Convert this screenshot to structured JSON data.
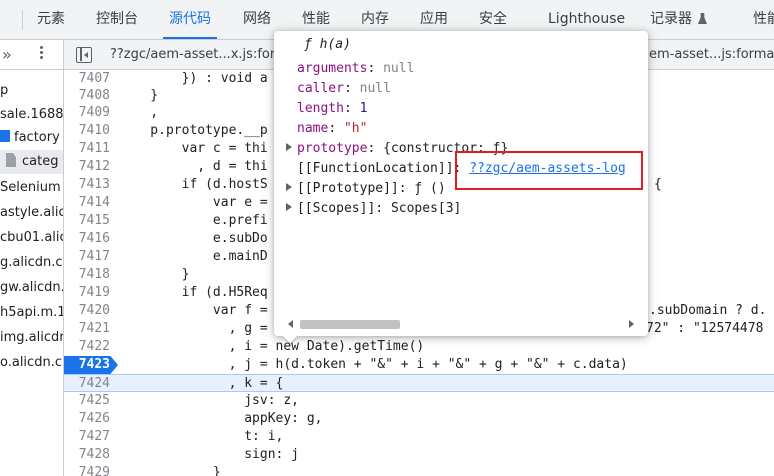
{
  "tabs": [
    {
      "label": "元素"
    },
    {
      "label": "控制台"
    },
    {
      "label": "源代码",
      "active": true
    },
    {
      "label": "网络"
    },
    {
      "label": "性能"
    },
    {
      "label": "内存"
    },
    {
      "label": "应用"
    },
    {
      "label": "安全"
    },
    {
      "label": "Lighthouse"
    },
    {
      "label": "记录器"
    },
    {
      "label": "性能"
    }
  ],
  "sidebar": {
    "expand_label": "»",
    "items": [
      {
        "label": "p"
      },
      {
        "label": "sale.1688."
      },
      {
        "label": "factory"
      },
      {
        "label": "categ"
      },
      {
        "label": "Selenium"
      },
      {
        "label": "astyle.alic"
      },
      {
        "label": "cbu01.alic"
      },
      {
        "label": "g.alicdn.c"
      },
      {
        "label": "gw.alicdn."
      },
      {
        "label": "h5api.m.1"
      },
      {
        "label": "img.alicdr"
      },
      {
        "label": "o.alicdn.c"
      }
    ]
  },
  "editor_tabs": [
    {
      "label": "??zgc/aem-asset...x.js:for"
    },
    {
      "label": "em-asset...js:format"
    }
  ],
  "code": {
    "lines": [
      {
        "n": "7407",
        "text": "        }) : void a"
      },
      {
        "n": "7408",
        "text": "    }"
      },
      {
        "n": "7409",
        "text": "    ,"
      },
      {
        "n": "7410",
        "text": "    p.prototype.__p"
      },
      {
        "n": "7411",
        "text": "        var c = thi"
      },
      {
        "n": "7412",
        "text": "          , d = thi"
      },
      {
        "n": "7413",
        "text": "        if (d.hostS"
      },
      {
        "n": "7414",
        "text": "            var e ="
      },
      {
        "n": "7415",
        "text": "            e.prefi"
      },
      {
        "n": "7416",
        "text": "            e.subDo"
      },
      {
        "n": "7417",
        "text": "            e.mainD"
      },
      {
        "n": "7418",
        "text": "        }"
      },
      {
        "n": "7419",
        "text": "        if (d.H5Req"
      },
      {
        "n": "7420",
        "text": "            var f ="
      },
      {
        "n": "7421",
        "text": "              , g ="
      },
      {
        "n": "7422",
        "text": "              , i = new Date).getTime()"
      },
      {
        "n": "7423",
        "text": "              , j = h(d.token + \"&\" + i + \"&\" + g + \"&\" + c.data)"
      },
      {
        "n": "7424",
        "text": "              , k = {"
      },
      {
        "n": "7425",
        "text": "                jsv: z,"
      },
      {
        "n": "7426",
        "text": "                appKey: g,"
      },
      {
        "n": "7427",
        "text": "                t: i,"
      },
      {
        "n": "7428",
        "text": "                sign: j"
      },
      {
        "n": "7429",
        "text": "            }"
      }
    ],
    "frag_7413": "{",
    "frag_7420": ".subDomain ? d.",
    "frag_7421": "72\" : \"12574478"
  },
  "popover": {
    "title": "ƒ h(a)",
    "rows": [
      {
        "key": "arguments",
        "value": "null",
        "kind": "null"
      },
      {
        "key": "caller",
        "value": "null",
        "kind": "null"
      },
      {
        "key": "length",
        "value": "1",
        "kind": "num"
      },
      {
        "key": "name",
        "value": "\"h\"",
        "kind": "str"
      },
      {
        "key": "prototype",
        "value": "{constructor: ƒ}",
        "kind": "obj"
      },
      {
        "key": "[[FunctionLocation]]",
        "value": "??zgc/aem-assets-log",
        "kind": "link"
      },
      {
        "key": "[[Prototype]]",
        "value": "ƒ ()",
        "kind": "obj"
      },
      {
        "key": "[[Scopes]]",
        "value": "Scopes[3]",
        "kind": "obj"
      }
    ]
  },
  "colors": {
    "accent": "#1a73e8",
    "highlight_box": "#e02020",
    "current_line": "#e8f0fe"
  }
}
